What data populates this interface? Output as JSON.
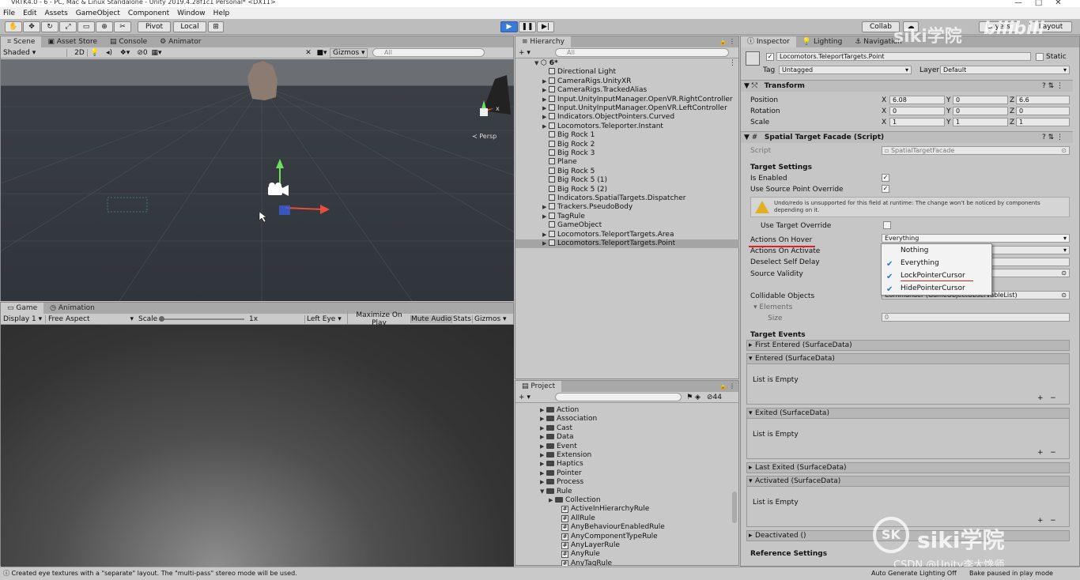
{
  "window": {
    "title": "VRTK4.0 - 6 - PC, Mac & Linux Standalone - Unity 2019.4.28f1c1 Personal* <DX11>"
  },
  "menu": [
    "File",
    "Edit",
    "Assets",
    "GameObject",
    "Component",
    "Window",
    "Help"
  ],
  "toolbar": {
    "pivot": "Pivot",
    "local": "Local",
    "collab": "Collab",
    "layers": "Layers",
    "layout": "Layout"
  },
  "scene_panel": {
    "tabs": [
      "Scene",
      "Asset Store",
      "Console",
      "Animator"
    ],
    "shading": "Shaded",
    "mode_2d": "2D",
    "gizmos": "Gizmos",
    "search_placeholder": "All",
    "persp": "Persp",
    "hidden_count": "0"
  },
  "game_panel": {
    "tabs": [
      "Game",
      "Animation"
    ],
    "display": "Display 1",
    "aspect": "Free Aspect",
    "scale_label": "Scale",
    "scale_value": "1x",
    "eye": "Left Eye",
    "buttons": [
      "Maximize On Play",
      "Mute Audio",
      "Stats",
      "Gizmos"
    ]
  },
  "hierarchy": {
    "tab": "Hierarchy",
    "search_placeholder": "All",
    "scene": "6*",
    "items": [
      {
        "label": "Directional Light",
        "expand": false
      },
      {
        "label": "CameraRigs.UnityXR",
        "expand": true
      },
      {
        "label": "CameraRigs.TrackedAlias",
        "expand": true
      },
      {
        "label": "Input.UnityInputManager.OpenVR.RightController",
        "expand": true
      },
      {
        "label": "Input.UnityInputManager.OpenVR.LeftController",
        "expand": true
      },
      {
        "label": "Indicators.ObjectPointers.Curved",
        "expand": true
      },
      {
        "label": "Locomotors.Teleporter.Instant",
        "expand": true
      },
      {
        "label": "Big Rock 1",
        "expand": false
      },
      {
        "label": "Big Rock 2",
        "expand": false
      },
      {
        "label": "Big Rock 3",
        "expand": false
      },
      {
        "label": "Plane",
        "expand": false
      },
      {
        "label": "Big Rock 5",
        "expand": false
      },
      {
        "label": "Big Rock 5 (1)",
        "expand": false
      },
      {
        "label": "Big Rock 5 (2)",
        "expand": false
      },
      {
        "label": "Indicators.SpatialTargets.Dispatcher",
        "expand": false
      },
      {
        "label": "Trackers.PseudoBody",
        "expand": true
      },
      {
        "label": "TagRule",
        "expand": true
      },
      {
        "label": "GameObject",
        "expand": false
      },
      {
        "label": "Locomotors.TeleportTargets.Area",
        "expand": true
      },
      {
        "label": "Locomotors.TeleportTargets.Point",
        "expand": true
      }
    ]
  },
  "project": {
    "tab": "Project",
    "count": "44",
    "folders": [
      "Action",
      "Association",
      "Cast",
      "Data",
      "Event",
      "Extension",
      "Haptics",
      "Pointer",
      "Process",
      "Rule"
    ],
    "subfolder": "Collection",
    "scripts": [
      "ActiveInHierarchyRule",
      "AllRule",
      "AnyBehaviourEnabledRule",
      "AnyComponentTypeRule",
      "AnyLayerRule",
      "AnyRule",
      "AnyTagRule"
    ]
  },
  "inspector": {
    "tabs": [
      "Inspector",
      "Lighting",
      "Navigation"
    ],
    "object_name": "Locomotors.TeleportTargets.Point",
    "static": "Static",
    "tag_label": "Tag",
    "tag": "Untagged",
    "layer_label": "Layer",
    "layer": "Default",
    "transform": {
      "title": "Transform",
      "position": {
        "label": "Position",
        "x": "6.08",
        "y": "0",
        "z": "6.6"
      },
      "rotation": {
        "label": "Rotation",
        "x": "0",
        "y": "0",
        "z": "0"
      },
      "scale": {
        "label": "Scale",
        "x": "1",
        "y": "1",
        "z": "1"
      }
    },
    "script_component": {
      "title": "Spatial Target Facade (Script)",
      "script_label": "Script",
      "script_value": "SpatialTargetFacade",
      "target_settings": "Target Settings",
      "is_enabled": "Is Enabled",
      "use_source_point_override": "Use Source Point Override",
      "warning": "Undo/redo is unsupported for this field at runtime: The change won't be noticed by components depending on it.",
      "use_target_override": "Use Target Override",
      "actions_on_hover": "Actions On Hover",
      "actions_on_hover_value": "Everything",
      "actions_on_activate": "Actions On Activate",
      "deselect_self_delay": "Deselect Self Delay",
      "source_validity": "Source Validity",
      "collidable_objects": "Collidable Objects",
      "collidable_value": "Commander (GameObjectObservableList)",
      "elements": "Elements",
      "size_label": "Size",
      "size_value": "0",
      "target_events": "Target Events",
      "list_empty": "List is Empty",
      "events": [
        "First Entered (SurfaceData)",
        "Entered (SurfaceData)",
        "Exited (SurfaceData)",
        "Last Exited (SurfaceData)",
        "Activated (SurfaceData)",
        "Deactivated ()"
      ],
      "reference_settings": "Reference Settings"
    },
    "dropdown_options": [
      {
        "label": "Nothing",
        "checked": false
      },
      {
        "label": "Everything",
        "checked": true
      },
      {
        "label": "LockPointerCursor",
        "checked": true
      },
      {
        "label": "HidePointerCursor",
        "checked": true
      }
    ]
  },
  "status": {
    "message": "Created eye textures with a \"separate\" layout. The \"multi-pass\" stereo mode will be used.",
    "right1": "Auto Generate Lighting Off",
    "right2": "Bake paused in play mode"
  },
  "watermark": {
    "brand": "siki学院",
    "csdn": "CSDN @Unity李大馋师",
    "bili": "bilibili"
  },
  "colors": {
    "accent": "#3b7ad6",
    "red_underline": "#e02020"
  }
}
